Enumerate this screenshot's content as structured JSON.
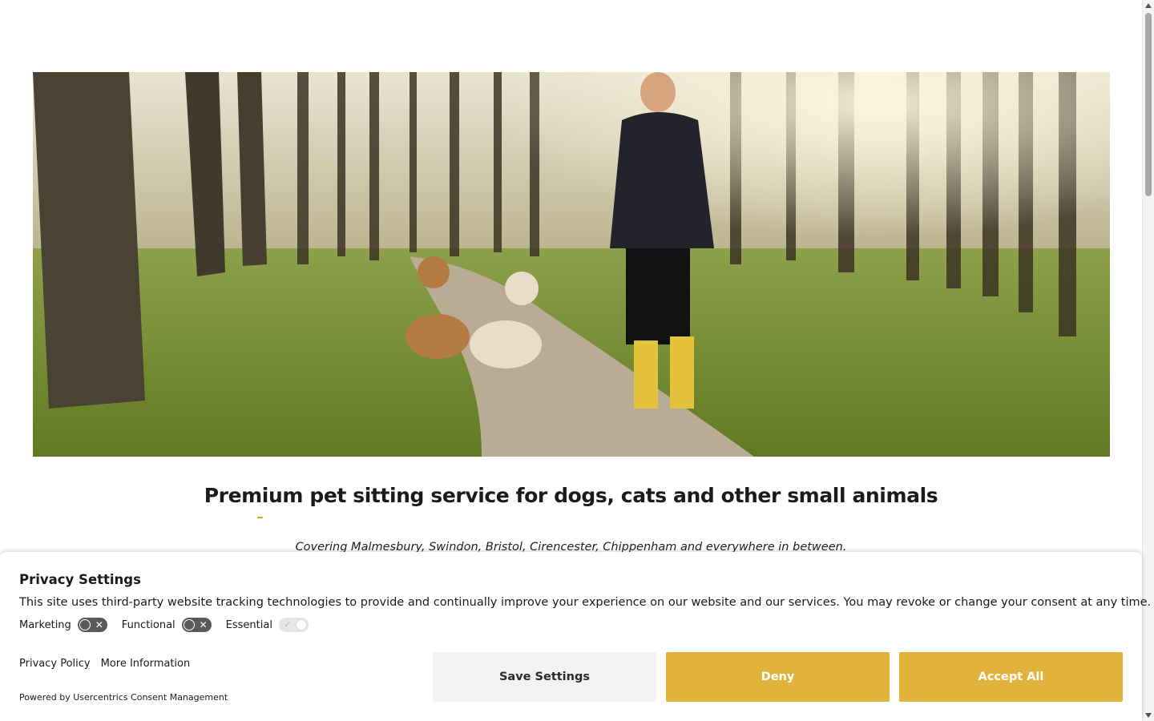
{
  "hero": {
    "image_description_icon": "hero-photo"
  },
  "headline": "Premium pet sitting service for dogs, cats and other small animals",
  "tagline": "Covering Malmesbury, Swindon, Bristol, Cirencester, Chippenham and everywhere in between.",
  "consent": {
    "title": "Privacy Settings",
    "text": "This site uses third-party website tracking technologies to provide and continually improve your experience on our website and our services. You may revoke or change your consent at any time.",
    "toggles": [
      {
        "label": "Marketing",
        "state": "off"
      },
      {
        "label": "Functional",
        "state": "off"
      },
      {
        "label": "Essential",
        "state": "on-disabled"
      }
    ],
    "links": {
      "privacy_policy": "Privacy Policy",
      "more_information": "More Information"
    },
    "powered_by": "Powered by Usercentrics Consent Management",
    "buttons": {
      "save": "Save Settings",
      "deny": "Deny",
      "accept": "Accept All"
    }
  },
  "colors": {
    "accent": "#e2b33b",
    "save_button_bg": "#f2f2f2",
    "toggle_off": "#5a5a5a"
  }
}
